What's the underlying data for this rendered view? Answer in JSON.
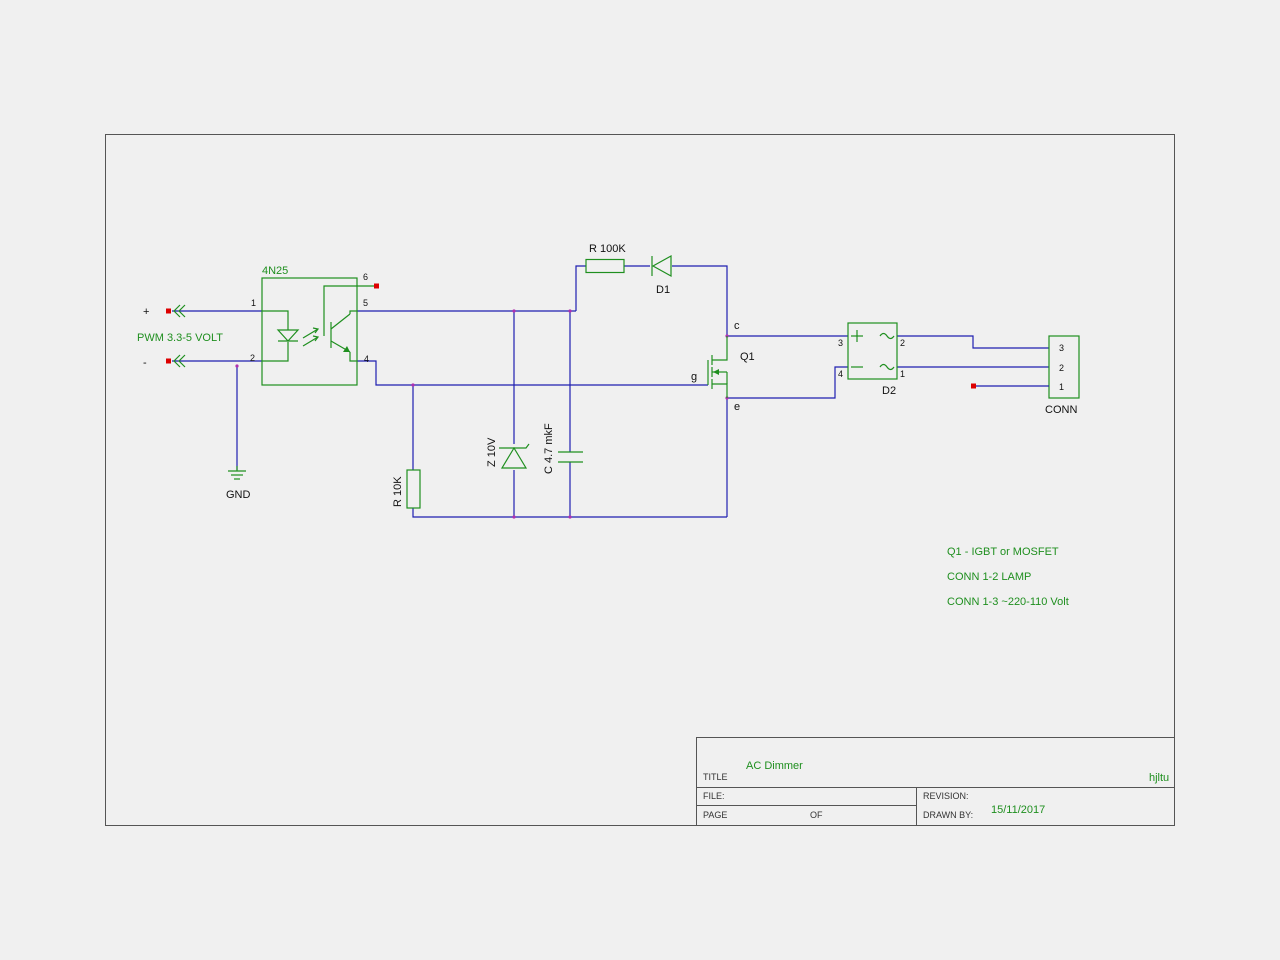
{
  "components": {
    "optocoupler": "4N25",
    "input_label": "PWM 3.3-5 VOLT",
    "input_plus": "+",
    "input_minus": "-",
    "gnd": "GND",
    "r100k": "R 100K",
    "d1": "D1",
    "q1": "Q1",
    "d2": "D2",
    "conn": "CONN",
    "r10k": "R 10K",
    "zener": "Z 10V",
    "cap": "C 4.7 mkF"
  },
  "pins": {
    "opto_1": "1",
    "opto_2": "2",
    "opto_4": "4",
    "opto_5": "5",
    "opto_6": "6",
    "q1_c": "c",
    "q1_g": "g",
    "q1_e": "e",
    "d2_3": "3",
    "d2_4": "4",
    "d2_2": "2",
    "d2_1": "1",
    "conn_3": "3",
    "conn_2": "2",
    "conn_1": "1"
  },
  "notes": [
    "Q1 - IGBT or MOSFET",
    "CONN 1-2 LAMP",
    "CONN 1-3 ~220-110 Volt"
  ],
  "title_block": {
    "title_label": "TITLE",
    "title_value": "AC Dimmer",
    "author": "hjltu",
    "file_label": "FILE:",
    "revision_label": "REVISION:",
    "page_label": "PAGE",
    "of_label": "OF",
    "drawn_by_label": "DRAWN BY:",
    "date": "15/11/2017"
  }
}
